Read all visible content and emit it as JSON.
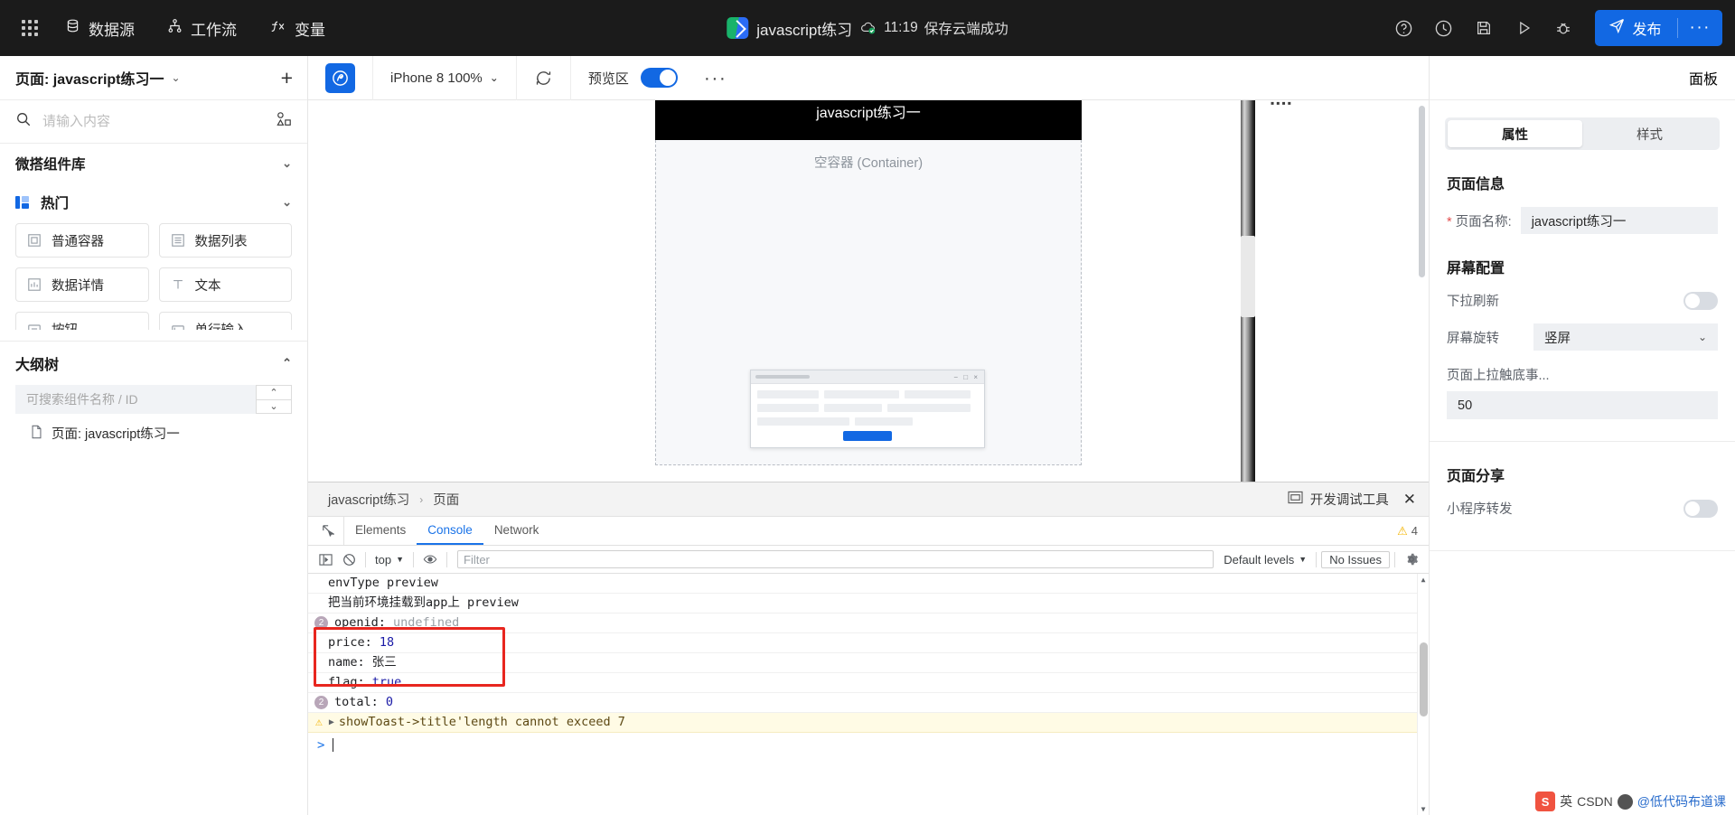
{
  "topbar": {
    "menu": [
      {
        "label": "数据源",
        "icon": "database-icon"
      },
      {
        "label": "工作流",
        "icon": "workflow-icon"
      },
      {
        "label": "变量",
        "icon": "fx-icon"
      }
    ],
    "project_title": "javascript练习",
    "save_time": "11:19",
    "save_status": "保存云端成功",
    "icons": [
      "help-icon",
      "history-icon",
      "save-icon",
      "preview-icon",
      "debug-icon"
    ],
    "publish_label": "发布",
    "more_label": "···",
    "accent_color": "#1268e3",
    "background": "#1b1b1b"
  },
  "sidebar": {
    "page_title": "页面: javascript练习一",
    "add_label": "+",
    "search_placeholder": "请输入内容",
    "library_title": "微搭组件库",
    "hot_title": "热门",
    "components": [
      {
        "label": "普通容器",
        "icon": "container-icon"
      },
      {
        "label": "数据列表",
        "icon": "list-icon"
      },
      {
        "label": "数据详情",
        "icon": "detail-icon"
      },
      {
        "label": "文本",
        "icon": "text-icon"
      },
      {
        "label": "按钮",
        "icon": "button-icon"
      },
      {
        "label": "单行输入",
        "icon": "input-icon"
      }
    ],
    "outline_title": "大纲树",
    "outline_search_placeholder": "可搜索组件名称 / ID",
    "tree_item": "页面: javascript练习一"
  },
  "canvas": {
    "wechat_icon": "wechat-miniprogram-icon",
    "device": "iPhone 8 100%",
    "refresh_icon": "refresh-icon",
    "preview_label": "预览区",
    "preview_on": true,
    "more_label": "···",
    "panel_label": "面板",
    "phone_title": "javascript练习一",
    "container_label": "空容器 (Container)"
  },
  "devtools": {
    "breadcrumb": [
      "javascript练习",
      "页面"
    ],
    "breadcrumb_sep": "›",
    "title": "开发调试工具",
    "close_label": "✕",
    "tabs": [
      {
        "label": "Elements",
        "active": false
      },
      {
        "label": "Console",
        "active": true
      },
      {
        "label": "Network",
        "active": false
      }
    ],
    "warning_count": "4",
    "filterbar": {
      "context": "top",
      "filter_placeholder": "Filter",
      "levels": "Default levels",
      "issues": "No Issues",
      "settings_icon": "gear-icon"
    },
    "console_rows": [
      {
        "type": "log",
        "text": "envType preview",
        "count": null
      },
      {
        "type": "log",
        "text": "把当前环境挂载到app上 preview",
        "count": null
      },
      {
        "type": "kv",
        "key": "openid:",
        "value": "undefined",
        "value_kind": "undefined",
        "count": "2"
      },
      {
        "type": "kv",
        "key": "price:",
        "value": "18",
        "value_kind": "number",
        "count": null,
        "highlighted": true
      },
      {
        "type": "kv",
        "key": "name:",
        "value": "张三",
        "value_kind": "string",
        "count": null,
        "highlighted": true
      },
      {
        "type": "kv",
        "key": "flag:",
        "value": "true",
        "value_kind": "boolean",
        "count": null,
        "highlighted": true
      },
      {
        "type": "kv",
        "key": "total:",
        "value": "0",
        "value_kind": "number",
        "count": "2"
      },
      {
        "type": "warning",
        "text": "showToast->title'length cannot exceed 7",
        "count": null
      }
    ],
    "prompt": ">",
    "highlight_color": "#e8261f"
  },
  "rightpanel": {
    "panel_label": "面板",
    "tabs": [
      {
        "label": "属性",
        "active": true
      },
      {
        "label": "样式",
        "active": false
      }
    ],
    "page_info_title": "页面信息",
    "page_name_label": "页面名称:",
    "page_name_value": "javascript练习一",
    "screen_config_title": "屏幕配置",
    "pull_refresh_label": "下拉刷新",
    "pull_refresh_on": false,
    "rotate_label": "屏幕旋转",
    "rotate_value": "竖屏",
    "pullup_label": "页面上拉触底事...",
    "pullup_value": "50",
    "share_title": "页面分享",
    "share_label": "小程序转发",
    "share_on": false
  },
  "watermark": {
    "app": "英",
    "text": "CSDN",
    "suffix": "@低代码布道课"
  }
}
